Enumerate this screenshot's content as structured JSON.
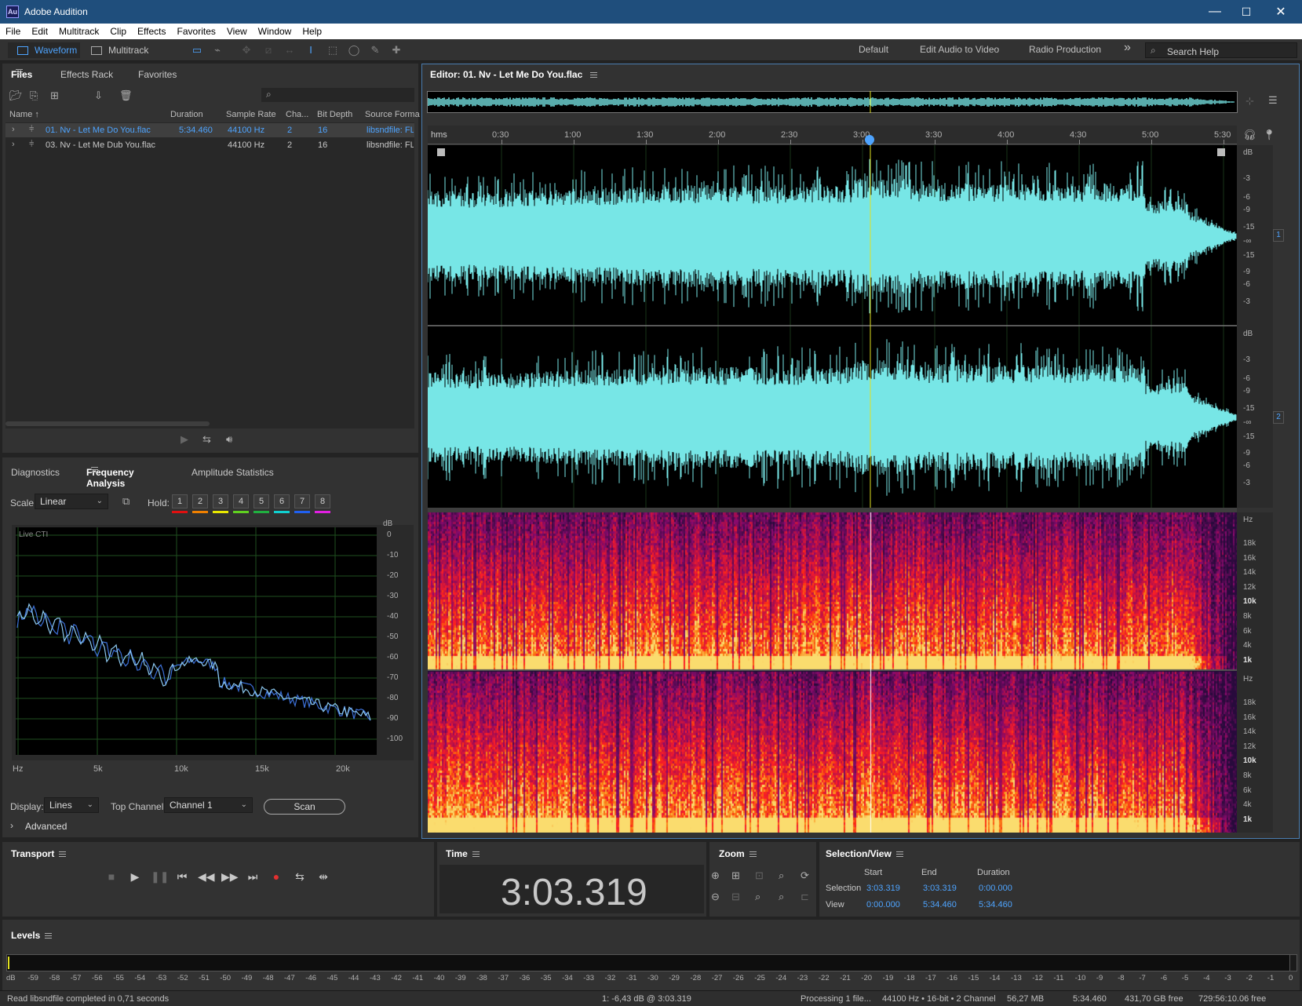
{
  "window": {
    "title": "Adobe Audition",
    "logo_text": "Au",
    "minimize": "—",
    "maximize": "☐",
    "close": "✕"
  },
  "menu": [
    "File",
    "Edit",
    "Multitrack",
    "Clip",
    "Effects",
    "Favorites",
    "View",
    "Window",
    "Help"
  ],
  "toolbar": {
    "waveform_label": "Waveform",
    "multitrack_label": "Multitrack",
    "workspaces": [
      "Default",
      "Edit Audio to Video",
      "Radio Production"
    ],
    "more": "»",
    "search_placeholder": "Search Help"
  },
  "files_panel": {
    "tabs": [
      "Files",
      "Effects Rack",
      "Favorites"
    ],
    "columns": [
      "Name",
      "Duration",
      "Sample Rate",
      "Cha...",
      "Bit Depth",
      "Source Forma"
    ],
    "rows": [
      {
        "name": "01. Nv - Let Me Do You.flac",
        "duration": "5:34.460",
        "rate": "44100 Hz",
        "channels": "2",
        "depth": "16",
        "format": "libsndfile: FL",
        "selected": true
      },
      {
        "name": "03. Nv - Let Me Dub You.flac",
        "duration": "",
        "rate": "44100 Hz",
        "channels": "2",
        "depth": "16",
        "format": "libsndfile: FL",
        "selected": false
      }
    ]
  },
  "analysis_panel": {
    "tabs": [
      "Diagnostics",
      "Frequency Analysis",
      "Amplitude Statistics"
    ],
    "scale_label": "Scale:",
    "scale_value": "Linear",
    "hold_label": "Hold:",
    "hold_buttons": [
      "1",
      "2",
      "3",
      "4",
      "5",
      "6",
      "7",
      "8"
    ],
    "hold_colors": [
      "#e01010",
      "#f08000",
      "#e8e800",
      "#60d020",
      "#20b040",
      "#10d0d0",
      "#2060f0",
      "#e020e0"
    ],
    "graph_label": "Live CTI",
    "db_unit": "dB",
    "db_ticks": [
      "0",
      "-10",
      "-20",
      "-30",
      "-40",
      "-50",
      "-60",
      "-70",
      "-80",
      "-90",
      "-100"
    ],
    "hz_unit": "Hz",
    "hz_ticks": [
      "5k",
      "10k",
      "15k",
      "20k"
    ],
    "display_label": "Display:",
    "display_value": "Lines",
    "top_channel_label": "Top Channel:",
    "top_channel_value": "Channel 1",
    "scan_label": "Scan",
    "advanced_label": "Advanced"
  },
  "editor": {
    "title": "Editor: 01. Nv - Let Me Do You.flac",
    "ruler_unit": "hms",
    "ruler_ticks": [
      "0:30",
      "1:00",
      "1:30",
      "2:00",
      "2:30",
      "3:00",
      "3:30",
      "4:00",
      "4:30",
      "5:00",
      "5:30"
    ],
    "db_unit": "dB",
    "db_ticks": [
      "-3",
      "-6",
      "-9",
      "-15",
      "-∞",
      "-15",
      "-9",
      "-6",
      "-3"
    ],
    "channel_1": "1",
    "channel_2": "2",
    "hz_unit": "Hz",
    "hz_ticks": [
      "18k",
      "16k",
      "14k",
      "12k",
      "10k",
      "8k",
      "6k",
      "4k",
      "1k"
    ]
  },
  "transport": {
    "title": "Transport"
  },
  "time": {
    "title": "Time",
    "value": "3:03.319"
  },
  "zoom": {
    "title": "Zoom"
  },
  "selection_view": {
    "title": "Selection/View",
    "headers": [
      "Start",
      "End",
      "Duration"
    ],
    "selection_label": "Selection",
    "selection": [
      "3:03.319",
      "3:03.319",
      "0:00.000"
    ],
    "view_label": "View",
    "view": [
      "0:00.000",
      "5:34.460",
      "5:34.460"
    ]
  },
  "levels": {
    "title": "Levels",
    "scale": [
      "dB",
      "-59",
      "-58",
      "-57",
      "-56",
      "-55",
      "-54",
      "-53",
      "-52",
      "-51",
      "-50",
      "-49",
      "-48",
      "-47",
      "-46",
      "-45",
      "-44",
      "-43",
      "-42",
      "-41",
      "-40",
      "-39",
      "-38",
      "-37",
      "-36",
      "-35",
      "-34",
      "-33",
      "-32",
      "-31",
      "-30",
      "-29",
      "-28",
      "-27",
      "-26",
      "-25",
      "-24",
      "-23",
      "-22",
      "-21",
      "-20",
      "-19",
      "-18",
      "-17",
      "-16",
      "-15",
      "-14",
      "-13",
      "-12",
      "-11",
      "-10",
      "-9",
      "-8",
      "-7",
      "-6",
      "-5",
      "-4",
      "-3",
      "-2",
      "-1",
      "0"
    ]
  },
  "status": {
    "left": "Read libsndfile completed in 0,71 seconds",
    "cursor": "1: -6,43 dB @ 3:03.319",
    "processing": "Processing 1 file...",
    "format": "44100 Hz • 16-bit • 2 Channel",
    "size": "56,27 MB",
    "duration": "5:34.460",
    "free": "431,70 GB free",
    "free_time": "729:56:10.06 free"
  },
  "colors": {
    "waveform": "#77e6e6",
    "accent": "#4ea4ff",
    "cti": "#e0e020",
    "titlebar": "#1f4e7c"
  }
}
